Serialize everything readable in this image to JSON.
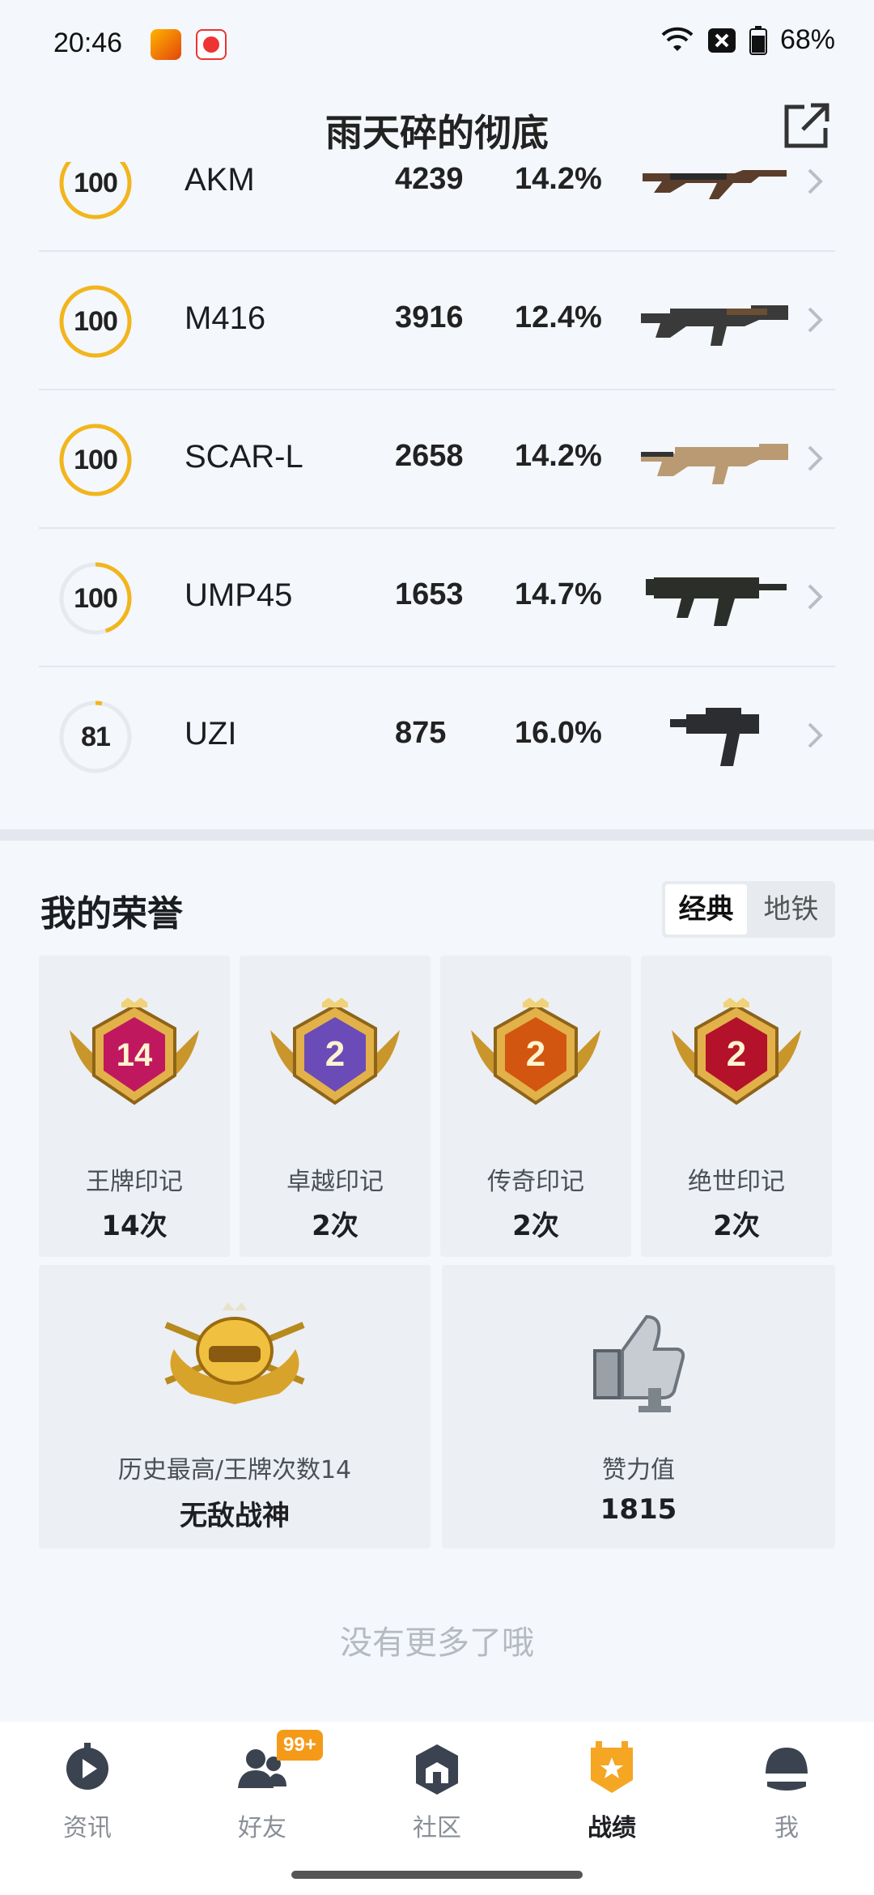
{
  "status_bar": {
    "time": "20:46",
    "battery": "68%"
  },
  "header": {
    "title": "雨天碎的彻底"
  },
  "weapons": [
    {
      "score": "100",
      "ring_fraction": 1.0,
      "name": "AKM",
      "kills": "4239",
      "rate": "14.2%",
      "gun_icon": "akm-rifle"
    },
    {
      "score": "100",
      "ring_fraction": 1.0,
      "name": "M416",
      "kills": "3916",
      "rate": "12.4%",
      "gun_icon": "m416-rifle"
    },
    {
      "score": "100",
      "ring_fraction": 1.0,
      "name": "SCAR-L",
      "kills": "2658",
      "rate": "14.2%",
      "gun_icon": "scar-l-rifle"
    },
    {
      "score": "100",
      "ring_fraction": 0.45,
      "name": "UMP45",
      "kills": "1653",
      "rate": "14.7%",
      "gun_icon": "ump45-smg"
    },
    {
      "score": "81",
      "ring_fraction": 0.03,
      "name": "UZI",
      "kills": "875",
      "rate": "16.0%",
      "gun_icon": "uzi-smg"
    }
  ],
  "honor": {
    "title": "我的荣誉",
    "modes": [
      "经典",
      "地铁"
    ],
    "active_mode": "经典",
    "marks": [
      {
        "badge_number": "14",
        "label": "王牌印记",
        "value": "14次",
        "color": "#c0185e"
      },
      {
        "badge_number": "2",
        "label": "卓越印记",
        "value": "2次",
        "color": "#6b4bb8"
      },
      {
        "badge_number": "2",
        "label": "传奇印记",
        "value": "2次",
        "color": "#d2560f"
      },
      {
        "badge_number": "2",
        "label": "绝世印记",
        "value": "2次",
        "color": "#b3122a"
      }
    ],
    "highest": {
      "label": "历史最高/王牌次数14",
      "value": "无敌战神"
    },
    "likes": {
      "label": "赞力值",
      "value": "1815"
    }
  },
  "end_text": "没有更多了哦",
  "nav": {
    "items": [
      {
        "label": "资讯",
        "icon": "news-icon"
      },
      {
        "label": "好友",
        "icon": "friends-icon",
        "badge": "99+"
      },
      {
        "label": "社区",
        "icon": "community-icon"
      },
      {
        "label": "战绩",
        "icon": "record-icon",
        "active": true
      },
      {
        "label": "我",
        "icon": "helmet-icon"
      }
    ]
  },
  "colors": {
    "ring": "#f2b51c",
    "ring_track": "#e6e9ee",
    "accent_gold": "#f5a623"
  }
}
